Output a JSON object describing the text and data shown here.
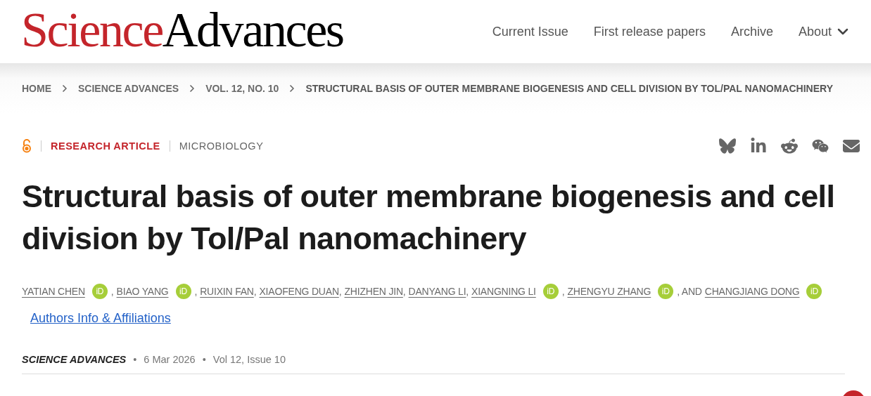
{
  "logo": {
    "first": "Science",
    "second": "Advances"
  },
  "nav": [
    {
      "label": "Current Issue",
      "kind": "link"
    },
    {
      "label": "First release papers",
      "kind": "link"
    },
    {
      "label": "Archive",
      "kind": "link"
    },
    {
      "label": "About",
      "kind": "dropdown"
    }
  ],
  "breadcrumb": [
    {
      "label": "HOME",
      "current": false
    },
    {
      "label": "SCIENCE ADVANCES",
      "current": false
    },
    {
      "label": "VOL. 12, NO. 10",
      "current": false
    },
    {
      "label": "STRUCTURAL BASIS OF OUTER MEMBRANE BIOGENESIS AND CELL DIVISION BY TOL/PAL NANOMACHINERY",
      "current": true
    }
  ],
  "article": {
    "open_access": true,
    "type": "RESEARCH ARTICLE",
    "subject": "MICROBIOLOGY",
    "share": [
      {
        "kind": "bluesky"
      },
      {
        "kind": "linkedin"
      },
      {
        "kind": "reddit"
      },
      {
        "kind": "wechat"
      },
      {
        "kind": "email"
      }
    ],
    "title": "Structural basis of outer membrane biogenesis and cell division by Tol/Pal nanomachinery",
    "authors": [
      {
        "name": "YATIAN CHEN",
        "orcid": "iD",
        "after": ","
      },
      {
        "name": "BIAO YANG",
        "orcid": "iD",
        "after": ","
      },
      {
        "name": "RUIXIN FAN",
        "after": ","
      },
      {
        "name": "XIAOFENG DUAN",
        "after": ","
      },
      {
        "name": "ZHIZHEN JIN",
        "after": ","
      },
      {
        "name": "DANYANG LI",
        "after": ","
      },
      {
        "name": "XIANGNING LI",
        "orcid": "iD",
        "after": ","
      },
      {
        "name": "ZHENGYU ZHANG",
        "orcid": "iD",
        "after": ", AND"
      },
      {
        "name": "CHANGJIANG DONG",
        "orcid": "iD"
      }
    ],
    "affiliations_link": "Authors Info & Affiliations",
    "journal": "SCIENCE ADVANCES",
    "date": "6 Mar 2026",
    "issue": "Vol 12, Issue 10",
    "separator": "•"
  }
}
